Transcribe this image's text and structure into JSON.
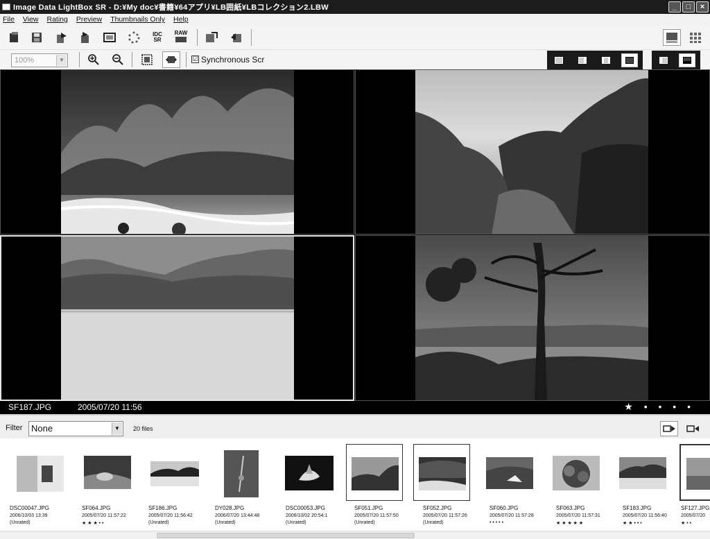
{
  "window": {
    "title": "Image Data LightBox SR - D:¥My doc¥書籍¥64アプリ¥LB囲紙¥LBコレクション2.LBW",
    "buttons": [
      "_",
      "□",
      "×"
    ]
  },
  "menu": [
    "File",
    "View",
    "Rating",
    "Preview",
    "Thumbnails Only",
    "Help"
  ],
  "toolbar": {
    "idc_label_1": "IDC",
    "idc_label_2": "SR",
    "raw_label": "RAW"
  },
  "toolbar2": {
    "zoom": "100%",
    "sync_label": "Synchronous Scr",
    "sync_checked": "☑"
  },
  "status": {
    "filename": "SF187.JPG",
    "datetime": "2005/07/20 11:56",
    "rating": "★ • • • •"
  },
  "filter": {
    "label": "Filter",
    "value": "None",
    "count": "20 files"
  },
  "thumbnails": [
    {
      "name": "DSC00047.JPG",
      "date": "2006/10/03 13:39",
      "rating": "(Unrated)"
    },
    {
      "name": "SF064.JPG",
      "date": "2005/07/20 11:57:22",
      "rating": "★ ★ ★ • •"
    },
    {
      "name": "SF186.JPG",
      "date": "2005/07/20 11:56:42",
      "rating": "(Unrated)"
    },
    {
      "name": "DY028.JPG",
      "date": "2006/07/20 13:44:48",
      "rating": "(Unrated)"
    },
    {
      "name": "DSC00053.JPG",
      "date": "2006/10/02 20:54:1",
      "rating": "(Unrated)"
    },
    {
      "name": "SF051.JPG",
      "date": "2005/07/20 11:57:50",
      "rating": "(Unrated)"
    },
    {
      "name": "SF052.JPG",
      "date": "2005/07/20 11:57:26",
      "rating": "(Unrated)"
    },
    {
      "name": "SF060.JPG",
      "date": "2005/07/20 11:57:28",
      "rating": "• • • • •"
    },
    {
      "name": "SF063.JPG",
      "date": "2005/07/20 11:57:31",
      "rating": "★ ★ ★ ★ ★"
    },
    {
      "name": "SF183.JPG",
      "date": "2005/07/20 11:56:40",
      "rating": "★ ★ • • •"
    },
    {
      "name": "SF127.JPG",
      "date": "2005/07/20",
      "rating": "★ • •"
    }
  ]
}
